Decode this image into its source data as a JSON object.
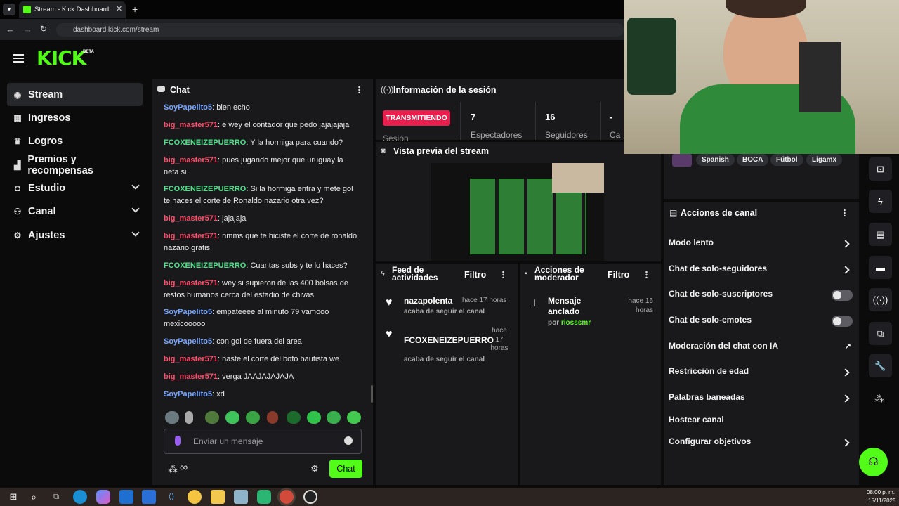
{
  "browser": {
    "tab_title": "Stream - Kick Dashboard",
    "url": "dashboard.kick.com/stream"
  },
  "app": {
    "logo": "KICK",
    "beta": "BETA",
    "accent": "#53fc18"
  },
  "sidebar": {
    "items": [
      {
        "label": "Stream",
        "icon": "stream-icon"
      },
      {
        "label": "Ingresos",
        "icon": "chart-icon"
      },
      {
        "label": "Logros",
        "icon": "trophy-icon"
      },
      {
        "label": "Premios y recompensas",
        "icon": "rewards-icon"
      },
      {
        "label": "Estudio",
        "icon": "studio-icon"
      },
      {
        "label": "Canal",
        "icon": "channel-icon"
      },
      {
        "label": "Ajustes",
        "icon": "gear-icon"
      }
    ]
  },
  "chat": {
    "title": "Chat",
    "placeholder": "Enviar un mensaje",
    "send": "Chat",
    "messages": [
      {
        "user": "SoyPapelito5",
        "color": "#77a6ff",
        "text": "bien echo"
      },
      {
        "user": "big_master571",
        "color": "#ff4d6a",
        "text": "e wey el contador que pedo jajajajaja"
      },
      {
        "user": "FCOXENEIZEPUERRO",
        "color": "#4ee38a",
        "text": "Y la hormiga para cuando?"
      },
      {
        "user": "big_master571",
        "color": "#ff4d6a",
        "text": "pues jugando mejor que uruguay la neta si"
      },
      {
        "user": "FCOXENEIZEPUERRO",
        "color": "#4ee38a",
        "text": "Si la hormiga entra y mete gol te haces el corte de Ronaldo nazario otra vez?"
      },
      {
        "user": "big_master571",
        "color": "#ff4d6a",
        "text": "jajajaja"
      },
      {
        "user": "big_master571",
        "color": "#ff4d6a",
        "text": "nmms que te hiciste el corte de ronaldo nazario gratis"
      },
      {
        "user": "FCOXENEIZEPUERRO",
        "color": "#4ee38a",
        "text": "Cuantas subs y te lo haces?"
      },
      {
        "user": "big_master571",
        "color": "#ff4d6a",
        "text": "wey si supieron de las 400 bolsas de restos humanos cerca del estadio de chivas"
      },
      {
        "user": "SoyPapelito5",
        "color": "#77a6ff",
        "text": "empateeee al minuto 79 vamooo mexicooooo"
      },
      {
        "user": "SoyPapelito5",
        "color": "#77a6ff",
        "text": "con gol de fuera del area"
      },
      {
        "user": "big_master571",
        "color": "#ff4d6a",
        "text": "haste el corte del bofo bautista we"
      },
      {
        "user": "big_master571",
        "color": "#ff4d6a",
        "text": "verga JAAJAJAJAJA"
      },
      {
        "user": "SoyPapelito5",
        "color": "#77a6ff",
        "text": "xd"
      }
    ]
  },
  "session": {
    "title": "Información de la sesión",
    "live": "TRANSMITIENDO",
    "live_color": "#e91e4c",
    "viewers": "7",
    "viewers_label": "Espectadores",
    "followers": "16",
    "followers_label": "Seguidores",
    "other": "-",
    "other_label": "Ca",
    "duration_label": "Sesión"
  },
  "preview": {
    "title": "Vista previa del stream"
  },
  "tags": [
    "Spanish",
    "BOCA",
    "Fútbol",
    "Ligamx"
  ],
  "feed": {
    "title": "Feed de actividades",
    "filter": "Filtro",
    "items": [
      {
        "user": "nazapolenta",
        "time": "hace 17 horas",
        "action": "acaba de seguir el canal"
      },
      {
        "user": "FCOXENEIZEPUERRO",
        "time": "hace 17 horas",
        "action": "acaba de seguir el canal"
      }
    ]
  },
  "mod": {
    "title": "Acciones de moderador",
    "filter": "Filtro",
    "item": {
      "title": "Mensaje anclado",
      "time": "hace 16 horas",
      "by": "por",
      "user": "riosssmr"
    }
  },
  "actions": {
    "title": "Acciones de canal",
    "rows": [
      {
        "label": "Modo lento",
        "kind": "arrow"
      },
      {
        "label": "Chat de solo-seguidores",
        "kind": "arrow"
      },
      {
        "label": "Chat de solo-suscriptores",
        "kind": "toggle"
      },
      {
        "label": "Chat de solo-emotes",
        "kind": "toggle"
      },
      {
        "label": "Moderación del chat con IA",
        "kind": "external"
      },
      {
        "label": "Restricción de edad",
        "kind": "arrow"
      },
      {
        "label": "Palabras baneadas",
        "kind": "arrow"
      },
      {
        "label": "Hostear canal",
        "kind": "none"
      },
      {
        "label": "Configurar objetivos",
        "kind": "arrow"
      }
    ]
  },
  "taskbar": {
    "time": "08:00 p. m.",
    "date": "15/11/2025"
  }
}
